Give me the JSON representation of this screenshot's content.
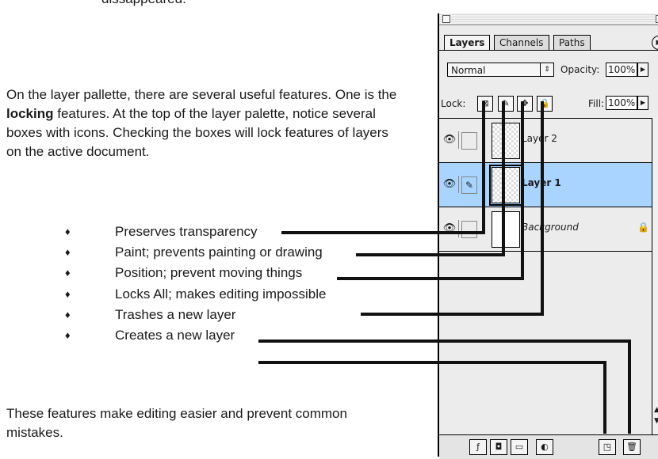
{
  "document": {
    "top_cutoff": "dissappeared.",
    "para1_before": "On the layer pallette, there are several useful features. One is the ",
    "para1_bold": "locking",
    "para1_after": " features.  At the top of the layer palette, notice several boxes with icons.  Checking the boxes will lock features of layers on the active document.",
    "bullet_symbol": "♦",
    "bullets": [
      "Preserves transparency",
      "Paint; prevents painting or drawing",
      "Position; prevent moving things",
      "Locks All; makes editing impossible",
      "Trashes a new layer",
      "Creates a new layer"
    ],
    "para2": "These features make editing easier and prevent common mistakes."
  },
  "palette": {
    "tabs": [
      "Layers",
      "Channels",
      "Paths"
    ],
    "blend_mode": "Normal",
    "opacity_label": "Opacity:",
    "opacity_value": "100%",
    "lock_label": "Lock:",
    "fill_label": "Fill:",
    "fill_value": "100%",
    "layers": [
      {
        "name": "Layer 2"
      },
      {
        "name": "Layer 1"
      },
      {
        "name": "Background"
      }
    ]
  }
}
